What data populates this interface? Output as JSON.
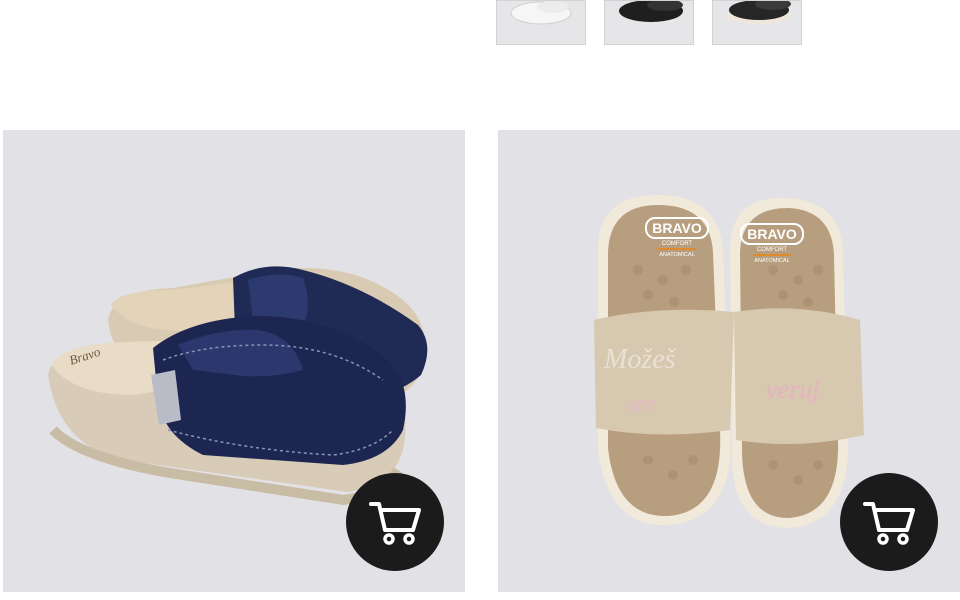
{
  "thumbnails": [
    {
      "name": "white-clog-thumbnail",
      "color": "#f4f4f4"
    },
    {
      "name": "black-clog-thumbnail",
      "color": "#1f1f1f"
    },
    {
      "name": "black-white-sole-clog-thumbnail",
      "color": "#262626"
    }
  ],
  "products": [
    {
      "image": "navy-leather-clogs",
      "brand_insole_text": "Bravo",
      "cart_icon": "shopping-cart-icon"
    },
    {
      "image": "beige-slide-sandals",
      "brand_logo": "BRAVO",
      "brand_sub1": "COMFORT",
      "brand_sub2": "ANATOMICAL",
      "left_strap_text_1": "Možeš",
      "left_strap_text_2": "ser",
      "right_strap_text": "veruj",
      "cart_icon": "shopping-cart-icon"
    }
  ],
  "colors": {
    "card_background": "#e2e1e5",
    "cart_button": "#1b1b1b",
    "navy": "#1f2a55",
    "beige": "#d8c8b0"
  }
}
